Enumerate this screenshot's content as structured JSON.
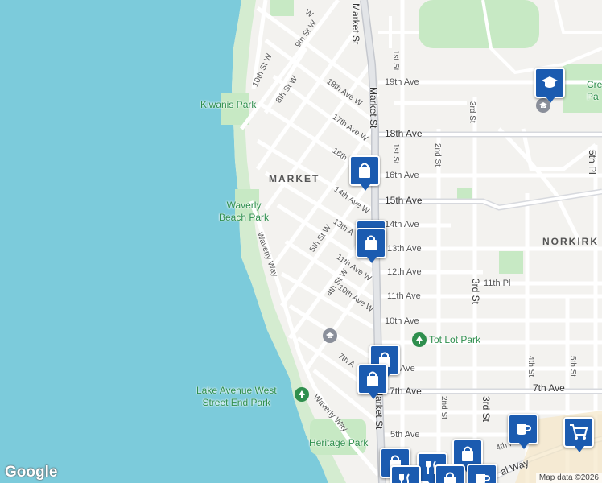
{
  "map": {
    "neighborhoods": [
      "MARKET",
      "NORKIRK"
    ],
    "parks": [
      {
        "id": "kiwanis",
        "lines": [
          "Kiwanis Park"
        ]
      },
      {
        "id": "waverly",
        "lines": [
          "Waverly",
          "Beach Park"
        ]
      },
      {
        "id": "tot-lot",
        "lines": [
          "Tot Lot Park"
        ]
      },
      {
        "id": "lake-ave",
        "lines": [
          "Lake Avenue West",
          "Street End Park"
        ]
      },
      {
        "id": "heritage",
        "lines": [
          "Heritage Park"
        ]
      },
      {
        "id": "crest",
        "lines": [
          "Cre",
          "Pa"
        ]
      }
    ],
    "streets": {
      "market_st_upper": "Market St",
      "market_st_mid": "Market St",
      "market_st_lower": "Market St",
      "ave_19th": "19th Ave",
      "ave_18th": "18th Ave",
      "ave_16th": "16th Ave",
      "ave_15th": "15th Ave",
      "ave_14th": "14th Ave",
      "ave_13th": "13th Ave",
      "ave_12th": "12th Ave",
      "ave_11th": "11th Ave",
      "ave_10th": "10th Ave",
      "ave_7th": "7th Ave",
      "ave_7th_east": "7th Ave",
      "ave_6th": "Ave",
      "ave_5th": "5th Ave",
      "place_11th": "11th Pl",
      "st_1st": "1st St",
      "st_1st_north": "1st St",
      "st_2nd": "2nd St",
      "st_2nd_south": "2nd St",
      "st_3rd": "3rd St",
      "st_3rd_lower": "3rd St",
      "st_3rd_bottom": "3rd St",
      "st_4th": "4th St",
      "st_5th": "5th St",
      "pl_5th": "5th Pl",
      "st_4th_cut": "4th P",
      "ave_w_18th": "18th Ave W",
      "ave_w_17th": "17th Ave W",
      "ave_w_16th": "16th",
      "ave_w_14th": "14th Ave W",
      "ave_w_13th": "13th A",
      "ave_w_11th": "11th Ave W",
      "ave_w_10th": "10th Ave W",
      "ave_w_7th": "7th A",
      "st_w_10th": "10th St W",
      "st_w_9th": "9th St W",
      "st_w_8th": "8th St W",
      "st_w_5th": "5th St W",
      "st_w_4th": "4th St W",
      "waverly_way_upper": "Waverly Way",
      "waverly_way_lower": "Waverly Way",
      "central_way": "al Way"
    },
    "icons": [
      "shopping-bag-icon",
      "restaurant-icon",
      "graduation-cap-icon",
      "school-icon",
      "tree-icon",
      "coffee-icon",
      "shopping-cart-icon"
    ]
  },
  "branding": {
    "logo": "Google"
  },
  "attribution": "Map data ©2026",
  "colors": {
    "water": "#7ccbdb",
    "park": "#c7e9c4",
    "marker": "#1b5bb0",
    "road": "#ffffff",
    "major_road": "#c9ccd3"
  }
}
